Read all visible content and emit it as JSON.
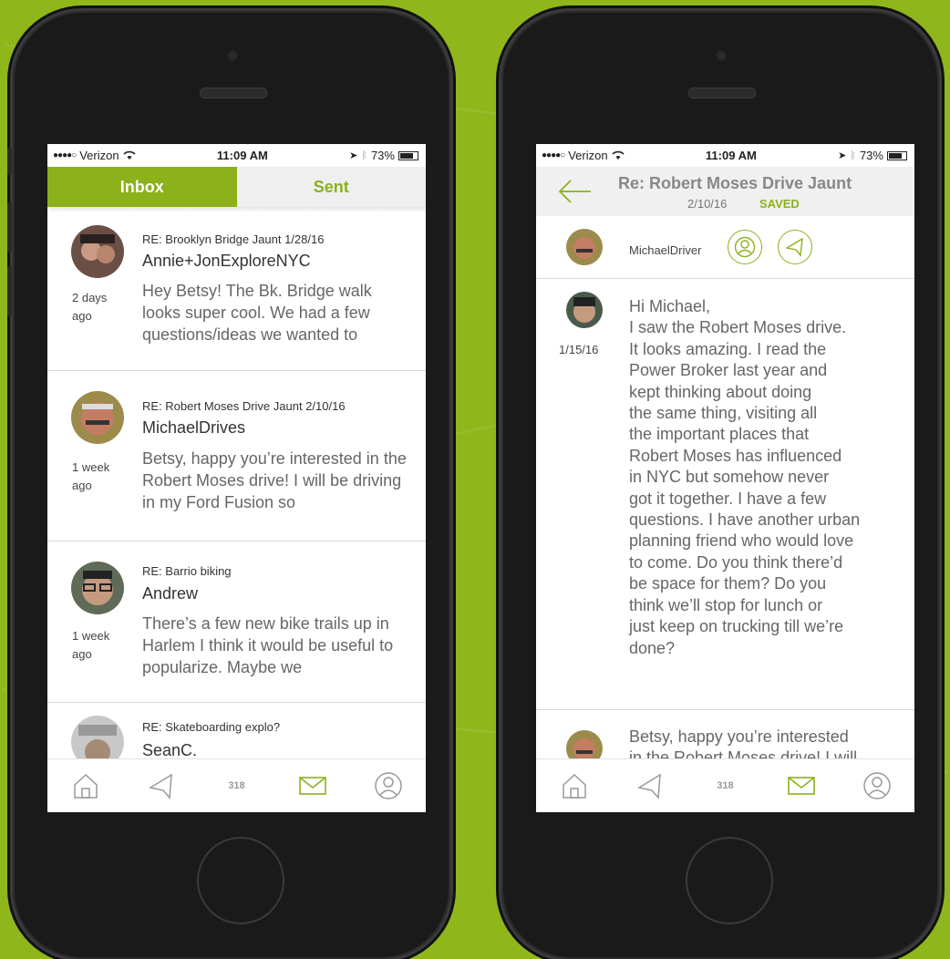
{
  "status_bar": {
    "carrier": "Verizon",
    "time": "11:09 AM",
    "battery": "73%",
    "battery_level": 0.73
  },
  "inbox_screen": {
    "tabs": [
      {
        "label": "Inbox",
        "active": true
      },
      {
        "label": "Sent",
        "active": false
      }
    ],
    "messages": [
      {
        "subject": "RE: Brooklyn Bridge Jaunt 1/28/16",
        "sender": "Annie+JonExploreNYC",
        "preview": "Hey Betsy! The Bk. Bridge walk looks super cool. We had a few questions/ideas we wanted to",
        "ago": "2 days ago"
      },
      {
        "subject": "RE:  Robert Moses Drive Jaunt 2/10/16",
        "sender": "MichaelDrives",
        "preview": "Betsy, happy you’re interested in the Robert Moses drive! I will be driving in my Ford Fusion so",
        "ago": "1 week ago"
      },
      {
        "subject": "RE: Barrio biking",
        "sender": "Andrew",
        "preview": "There’s a few new bike trails up in Harlem I think it would be useful to popularize. Maybe we",
        "ago": "1 week ago"
      },
      {
        "subject": "RE:  Skateboarding explo?",
        "sender": "SeanC.",
        "preview": "",
        "ago": ""
      }
    ]
  },
  "detail_screen": {
    "title": "Re: Robert Moses Drive Jaunt",
    "date": "2/10/16",
    "saved_label": "SAVED",
    "participant": "MichaelDriver",
    "messages": [
      {
        "date": "1/15/16",
        "text": "Hi Michael,\nI saw the Robert Moses drive.\nIt looks amazing. I read the\nPower Broker last year and\nkept thinking about doing\nthe same thing, visiting all\nthe important places that\nRobert Moses has influenced\nin NYC but somehow never\ngot it together. I have a few\nquestions. I have another urban\nplanning friend who would love\nto come. Do you think there’d\nbe space for them? Do you\nthink we’ll stop for lunch or\njust keep on trucking till we’re\ndone?"
      },
      {
        "date": "",
        "text": "Betsy, happy you’re interested\nin the Robert Moses drive! I will"
      }
    ]
  },
  "tab_bar": {
    "items": [
      {
        "icon": "home-icon"
      },
      {
        "icon": "explore-icon"
      },
      {
        "icon": "points-icon",
        "label": "318"
      },
      {
        "icon": "mail-icon",
        "active": true
      },
      {
        "icon": "profile-icon"
      }
    ]
  },
  "colors": {
    "accent": "#8cb11a",
    "background": "#8fb71b"
  }
}
